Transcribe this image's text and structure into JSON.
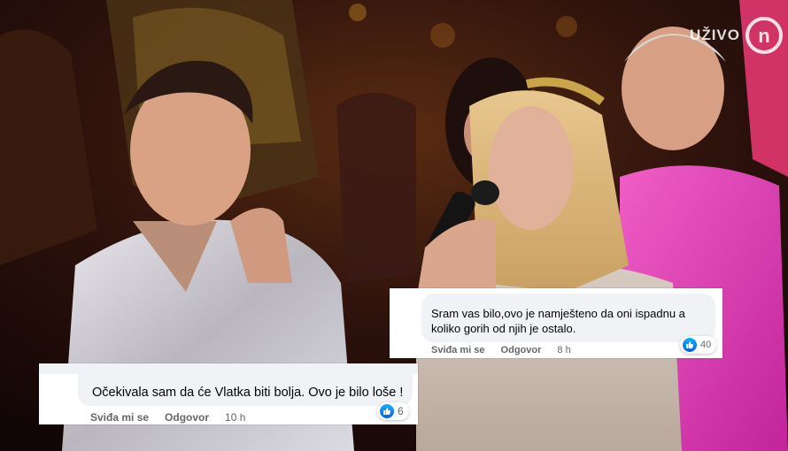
{
  "watermark": {
    "live_label": "UŽIVO",
    "logo_letter": "n"
  },
  "comments": [
    {
      "text": "Očekivala sam da će Vlatka biti bolja. Ovo je bilo loše !",
      "like_label": "Sviđa mi se",
      "reply_label": "Odgovor",
      "time": "10 h",
      "reaction_count": "6"
    },
    {
      "text": "Sram vas bilo,ovo je namješteno da oni ispadnu a koliko gorih od njih je ostalo.",
      "like_label": "Sviđa mi se",
      "reply_label": "Odgovor",
      "time": "8 h",
      "reaction_count": "40"
    }
  ],
  "colors": {
    "like_blue": "#0866ff",
    "pink_shirt": "#e23bb0",
    "stage_gold": "#b8892a"
  }
}
